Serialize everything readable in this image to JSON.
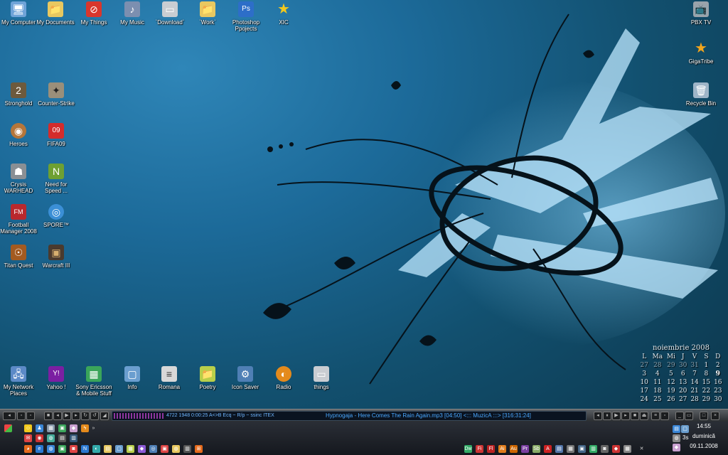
{
  "desktop": {
    "icons": [
      {
        "label": "My Computer",
        "icon": "computer-icon",
        "glyph": "🖥",
        "color": "#6fa3d8"
      },
      {
        "label": "My Documents",
        "icon": "folder-icon",
        "glyph": "📁",
        "color": "#e8c860"
      },
      {
        "label": "My Things",
        "icon": "things-icon",
        "glyph": "⊘",
        "color": "#d9362c"
      },
      {
        "label": "My Music",
        "icon": "music-icon",
        "glyph": "♪",
        "color": "#7c8fb0"
      },
      {
        "label": "`Download`",
        "icon": "drive-icon",
        "glyph": "▭",
        "color": "#c9cdd2"
      },
      {
        "label": "`Work`",
        "icon": "folder-icon",
        "glyph": "📁",
        "color": "#e8c860"
      },
      {
        "label": "Photoshop\nPpojects",
        "icon": "photoshop-icon",
        "glyph": "Ps",
        "color": "#2d6ec8"
      },
      {
        "label": "XIC",
        "icon": "star-icon",
        "glyph": "★",
        "color": "#f2c81d"
      },
      {
        "label": "Stronghold",
        "icon": "stronghold-icon",
        "glyph": "2",
        "color": "#6d5a3d"
      },
      {
        "label": "Counter-Strike",
        "icon": "counter-strike-icon",
        "glyph": "✦",
        "color": "#9a8f7a"
      },
      {
        "label": "Heroes",
        "icon": "heroes-icon",
        "glyph": "◉",
        "color": "#b5763a"
      },
      {
        "label": "FIFA09",
        "icon": "fifa-icon",
        "glyph": "09",
        "color": "#d42c2c"
      },
      {
        "label": "Crysis\nWARHEAD",
        "icon": "crysis-icon",
        "glyph": "☗",
        "color": "#8a8f94"
      },
      {
        "label": "Need for\nSpeed ...",
        "icon": "nfs-icon",
        "glyph": "N",
        "color": "#6ea032"
      },
      {
        "label": "Football\nManager 2008",
        "icon": "football-manager-icon",
        "glyph": "FM",
        "color": "#b9282d"
      },
      {
        "label": "SPORE™",
        "icon": "spore-icon",
        "glyph": "◎",
        "color": "#3b8fd6"
      },
      {
        "label": "Titan Quest",
        "icon": "titan-quest-icon",
        "glyph": "☉",
        "color": "#a35a20"
      },
      {
        "label": "Warcraft III",
        "icon": "warcraft-icon",
        "glyph": "▣",
        "color": "#4a3a2e"
      },
      {
        "label": "My Network\nPlaces",
        "icon": "network-icon",
        "glyph": "🖧",
        "color": "#5c8ac7"
      },
      {
        "label": "Yahoo !",
        "icon": "yahoo-icon",
        "glyph": "Y!",
        "color": "#7b1fa2"
      },
      {
        "label": "Sony Ericsson\n& Mobile Stuff",
        "icon": "sony-ericsson-icon",
        "glyph": "▦",
        "color": "#3aa55a"
      },
      {
        "label": "Info",
        "icon": "info-icon",
        "glyph": "▢",
        "color": "#6a9ecf"
      },
      {
        "label": "Romana",
        "icon": "document-icon",
        "glyph": "≡",
        "color": "#d8d8d8"
      },
      {
        "label": "Poetry",
        "icon": "folder-icon",
        "glyph": "📁",
        "color": "#b8cf4a"
      },
      {
        "label": "Icon Saver",
        "icon": "icon-saver-icon",
        "glyph": "⚙",
        "color": "#4f7fb5"
      },
      {
        "label": "Radio",
        "icon": "radio-icon",
        "glyph": "◐",
        "color": "#e48a1c"
      },
      {
        "label": "things",
        "icon": "drive-icon",
        "glyph": "▭",
        "color": "#c9cdd2"
      },
      {
        "label": "PBX TV",
        "icon": "tv-icon",
        "glyph": "📺",
        "color": "#9aa3ab"
      },
      {
        "label": "GigaTribe",
        "icon": "gigatribe-icon",
        "glyph": "★",
        "color": "#f2a51d"
      },
      {
        "label": "Recycle Bin",
        "icon": "recycle-bin-icon",
        "glyph": "🗑",
        "color": "#9fb5c8"
      }
    ]
  },
  "calendar": {
    "title": "noiembrie 2008",
    "headers": [
      "L",
      "Ma",
      "Mi",
      "J",
      "V",
      "S",
      "D"
    ],
    "weeks": [
      [
        "27",
        "28",
        "29",
        "30",
        "31",
        "1",
        "2"
      ],
      [
        "3",
        "4",
        "5",
        "6",
        "7",
        "8",
        "9"
      ],
      [
        "10",
        "11",
        "12",
        "13",
        "14",
        "15",
        "16"
      ],
      [
        "17",
        "18",
        "19",
        "20",
        "21",
        "22",
        "23"
      ],
      [
        "24",
        "25",
        "26",
        "27",
        "28",
        "29",
        "30"
      ]
    ],
    "today": "9"
  },
  "player": {
    "stats": "4722  1948  0:00:25    A<>B   Ecq ~   R/p ~   ssinc  ITEX",
    "track": "Hypnogaja - Here Comes The Rain Again.mp3  [04:50]    <::: MuzicA :::>    [316:31:24]"
  },
  "taskbar": {
    "time": "14:55",
    "day": "duminică",
    "date": "09.11.2008",
    "tray_label": "3s"
  }
}
